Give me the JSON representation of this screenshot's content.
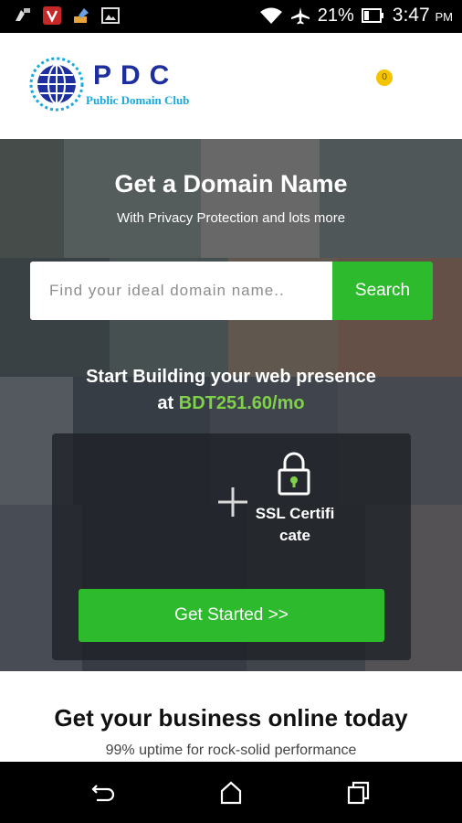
{
  "status_bar": {
    "left_icons": [
      "paint-app-icon",
      "vivaldi-icon",
      "brush-app-icon",
      "image-icon"
    ],
    "battery_percent": "21%",
    "time": "3:47",
    "ampm": "PM"
  },
  "header": {
    "logo_title": "PDC",
    "logo_subtitle": "Public Domain Club",
    "cart_count": "0"
  },
  "hero": {
    "title": "Get a Domain Name",
    "subtitle": "With Privacy Protection and lots more",
    "search_placeholder": "Find your ideal domain name..",
    "search_button": "Search",
    "start_line1": "Start Building your web presence",
    "start_prefix": "at ",
    "price": "BDT251.60/mo",
    "ssl_label": "SSL Certificate",
    "cta_button": "Get Started >>"
  },
  "section2": {
    "title": "Get your business online today",
    "subtitle": "99% uptime for rock-solid performance"
  },
  "colors": {
    "accent_green": "#2dba2d",
    "price_green": "#7fd14a",
    "logo_blue": "#1d2f9e",
    "logo_cyan": "#18a9e0",
    "badge_yellow": "#f5c400"
  },
  "nav": [
    "back-icon",
    "home-icon",
    "recents-icon"
  ]
}
